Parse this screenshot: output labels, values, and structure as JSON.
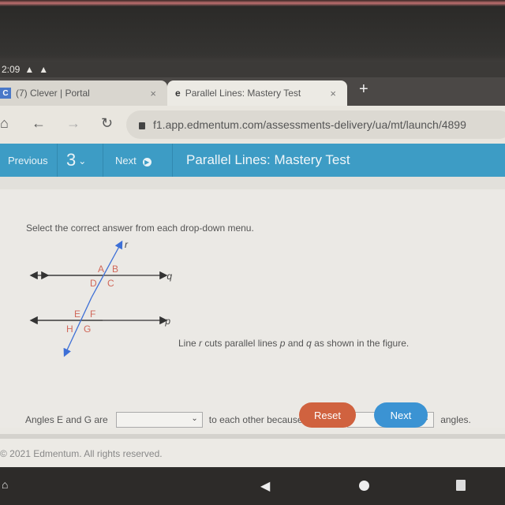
{
  "status_bar": {
    "time": "2:09",
    "icons": [
      "warning-icon",
      "warning-icon"
    ]
  },
  "browser": {
    "tabs": [
      {
        "label": "(7) Clever | Portal",
        "favicon": "clever-c-icon",
        "active": false
      },
      {
        "label": "Parallel Lines: Mastery Test",
        "favicon": "edmentum-e-icon",
        "active": true
      }
    ],
    "new_tab": "+",
    "close_glyph": "×",
    "url": "f1.app.edmentum.com/assessments-delivery/ua/mt/launch/4899"
  },
  "test_header": {
    "previous_label": "Previous",
    "question_number": "3",
    "next_label": "Next",
    "title": "Parallel Lines: Mastery Test",
    "color": "#3d9cc5"
  },
  "question": {
    "prompt": "Select the correct answer from each drop-down menu.",
    "statement_parts": [
      "Line ",
      "r",
      " cuts parallel lines ",
      "p",
      " and ",
      "q",
      " as shown in the figure."
    ],
    "figure": {
      "lines": [
        "q",
        "p",
        "r"
      ],
      "angle_labels_top": [
        "A",
        "B",
        "D",
        "C"
      ],
      "angle_labels_bottom": [
        "E",
        "F",
        "H",
        "G"
      ]
    },
    "answer": {
      "before": "Angles E and G are",
      "middle": "to each other because they are",
      "after": "angles.",
      "dropdown1_value": "",
      "dropdown2_value": ""
    },
    "reset_label": "Reset",
    "next_label": "Next"
  },
  "footer": {
    "copyright": "© 2021 Edmentum. All rights reserved."
  },
  "colors": {
    "reset": "#d0623f",
    "next": "#3b93d3",
    "angle_label": "#d0685a",
    "transversal": "#3d6fd6"
  }
}
